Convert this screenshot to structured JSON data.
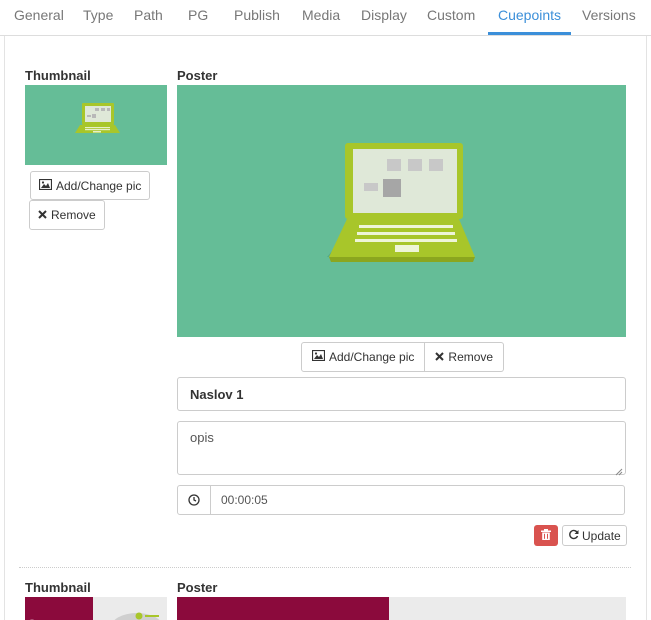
{
  "tabs": [
    {
      "label": "General"
    },
    {
      "label": "Type"
    },
    {
      "label": "Path"
    },
    {
      "label": "PG"
    },
    {
      "label": "Publish"
    },
    {
      "label": "Media"
    },
    {
      "label": "Display"
    },
    {
      "label": "Custom"
    },
    {
      "label": "Cuepoints",
      "active": true
    },
    {
      "label": "Versions"
    }
  ],
  "cuepoint1": {
    "thumbnail_label": "Thumbnail",
    "poster_label": "Poster",
    "add_change_label": "Add/Change pic",
    "remove_label": "Remove",
    "title_value": "Naslov 1",
    "description_value": "opis",
    "time_value": "00:00:05",
    "update_label": "Update"
  },
  "cuepoint2": {
    "thumbnail_label": "Thumbnail",
    "poster_label": "Poster"
  },
  "colors": {
    "accent": "#3b8fd9",
    "image_bg": "#65bd97",
    "laptop": "#a8c62a",
    "danger": "#d9534f",
    "cue2_thumb": "#8b0a3c"
  }
}
